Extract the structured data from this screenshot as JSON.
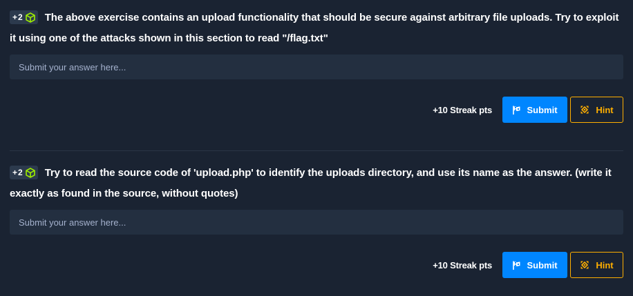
{
  "questions": [
    {
      "points": "+2",
      "badge_icon": "cube-icon",
      "text": "The above exercise contains an upload functionality that should be secure against arbitrary file uploads. Try to exploit it using one of the attacks shown in this section to read \"/flag.txt\"",
      "answer_placeholder": "Submit your answer here...",
      "answer_value": "",
      "streak": "+10 Streak pts",
      "submit_label": "Submit",
      "hint_label": "Hint"
    },
    {
      "points": "+2",
      "badge_icon": "cube-icon",
      "text": "Try to read the source code of 'upload.php' to identify the uploads directory, and use its name as the answer. (write it exactly as found in the source, without quotes)",
      "answer_placeholder": "Submit your answer here...",
      "answer_value": "",
      "streak": "+10 Streak pts",
      "submit_label": "Submit",
      "hint_label": "Hint"
    }
  ],
  "colors": {
    "background": "#1a2332",
    "input_background": "#232f40",
    "submit": "#0086ff",
    "hint": "#ffaf00",
    "cube": "#9fef00"
  },
  "icons": {
    "submit": "flag-icon",
    "hint": "hint-icon"
  }
}
